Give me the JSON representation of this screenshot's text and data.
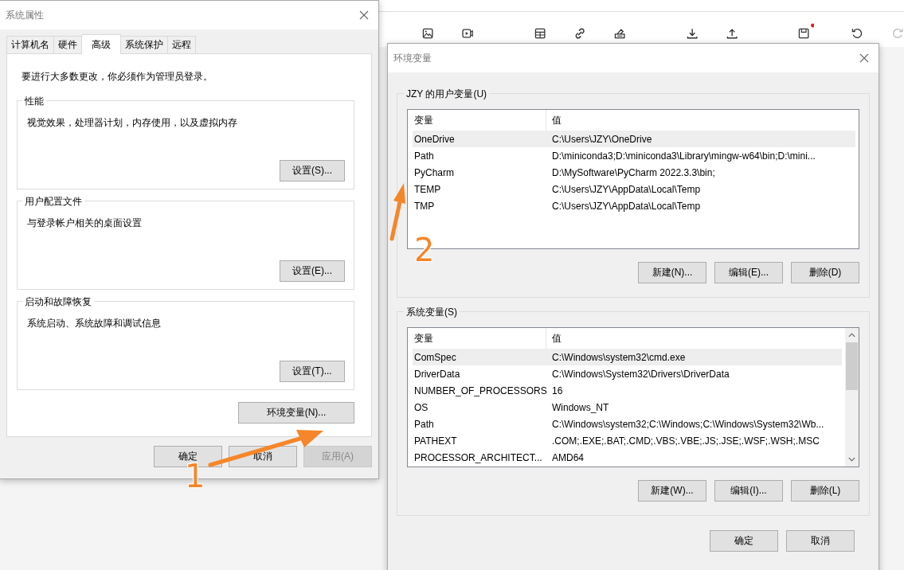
{
  "system_properties": {
    "title": "系统属性",
    "tabs": [
      {
        "label": "计算机名",
        "selected": false
      },
      {
        "label": "硬件",
        "selected": false
      },
      {
        "label": "高级",
        "selected": true
      },
      {
        "label": "系统保护",
        "selected": false
      },
      {
        "label": "远程",
        "selected": false
      }
    ],
    "notice": "要进行大多数更改，你必须作为管理员登录。",
    "groups": [
      {
        "title": "性能",
        "description": "视觉效果，处理器计划，内存使用，以及虚拟内存",
        "button": "设置(S)..."
      },
      {
        "title": "用户配置文件",
        "description": "与登录帐户相关的桌面设置",
        "button": "设置(E)..."
      },
      {
        "title": "启动和故障恢复",
        "description": "系统启动、系统故障和调试信息",
        "button": "设置(T)..."
      }
    ],
    "env_button": "环境变量(N)...",
    "buttons": [
      {
        "label": "确定",
        "disabled": false
      },
      {
        "label": "取消",
        "disabled": false
      },
      {
        "label": "应用(A)",
        "disabled": true
      }
    ]
  },
  "environment_variables": {
    "title": "环境变量",
    "user_vars": {
      "title": "JZY 的用户变量(U)",
      "columns": [
        "变量",
        "值"
      ],
      "rows": [
        {
          "name": "OneDrive",
          "value": "C:\\Users\\JZY\\OneDrive",
          "selected": true
        },
        {
          "name": "Path",
          "value": "D:\\miniconda3;D:\\miniconda3\\Library\\mingw-w64\\bin;D:\\mini...",
          "selected": false
        },
        {
          "name": "PyCharm",
          "value": "D:\\MySoftware\\PyCharm 2022.3.3\\bin;",
          "selected": false
        },
        {
          "name": "TEMP",
          "value": "C:\\Users\\JZY\\AppData\\Local\\Temp",
          "selected": false
        },
        {
          "name": "TMP",
          "value": "C:\\Users\\JZY\\AppData\\Local\\Temp",
          "selected": false
        }
      ],
      "buttons": [
        "新建(N)...",
        "编辑(E)...",
        "删除(D)"
      ]
    },
    "system_vars": {
      "title": "系统变量(S)",
      "columns": [
        "变量",
        "值"
      ],
      "rows": [
        {
          "name": "ComSpec",
          "value": "C:\\Windows\\system32\\cmd.exe",
          "selected": true
        },
        {
          "name": "DriverData",
          "value": "C:\\Windows\\System32\\Drivers\\DriverData",
          "selected": false
        },
        {
          "name": "NUMBER_OF_PROCESSORS",
          "value": "16",
          "selected": false
        },
        {
          "name": "OS",
          "value": "Windows_NT",
          "selected": false
        },
        {
          "name": "Path",
          "value": "C:\\Windows\\system32;C:\\Windows;C:\\Windows\\System32\\Wb...",
          "selected": false
        },
        {
          "name": "PATHEXT",
          "value": ".COM;.EXE;.BAT;.CMD;.VBS;.VBE;.JS;.JSE;.WSF;.WSH;.MSC",
          "selected": false
        },
        {
          "name": "PROCESSOR_ARCHITECT...",
          "value": "AMD64",
          "selected": false
        }
      ],
      "buttons": [
        "新建(W)...",
        "编辑(I)...",
        "删除(L)"
      ]
    },
    "buttons": [
      "确定",
      "取消"
    ]
  },
  "annotations": [
    {
      "label": "1"
    },
    {
      "label": "2"
    }
  ]
}
